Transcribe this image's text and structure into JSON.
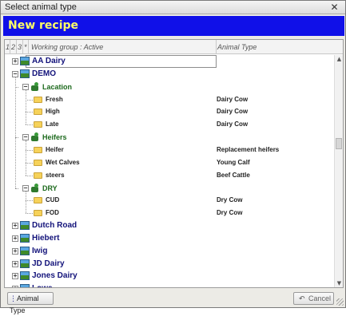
{
  "window": {
    "title": "Select animal type",
    "close_glyph": "✕"
  },
  "banner": {
    "title": "New recipe"
  },
  "grid": {
    "header": {
      "col1": "1",
      "col2": "2",
      "col3": "3",
      "col4": "*",
      "working_group": "Working group : Active",
      "animal_type": "Animal Type"
    }
  },
  "tree": [
    {
      "kind": "top",
      "label": "AA Dairy",
      "expander": "+",
      "selected": true
    },
    {
      "kind": "top",
      "label": "DEMO",
      "expander": "−"
    },
    {
      "kind": "group",
      "label": "Lacation",
      "expander": "−"
    },
    {
      "kind": "leaf",
      "label": "Fresh",
      "animal_type": "Dairy Cow"
    },
    {
      "kind": "leaf",
      "label": "High",
      "animal_type": "Dairy Cow"
    },
    {
      "kind": "leaf",
      "label": "Late",
      "animal_type": "Dairy Cow"
    },
    {
      "kind": "group",
      "label": "Heifers",
      "expander": "−"
    },
    {
      "kind": "leaf",
      "label": "Heifer",
      "animal_type": "Replacement heifers"
    },
    {
      "kind": "leaf",
      "label": "Wet Calves",
      "animal_type": "Young Calf"
    },
    {
      "kind": "leaf",
      "label": "steers",
      "animal_type": "Beef Cattle"
    },
    {
      "kind": "group",
      "label": "DRY",
      "expander": "−"
    },
    {
      "kind": "leaf",
      "label": "CUD",
      "animal_type": "Dry Cow"
    },
    {
      "kind": "leaf",
      "label": "FOD",
      "animal_type": "Dry Cow"
    },
    {
      "kind": "top",
      "label": "Dutch Road",
      "expander": "+"
    },
    {
      "kind": "top",
      "label": "Hiebert",
      "expander": "+"
    },
    {
      "kind": "top",
      "label": "Iwig",
      "expander": "+"
    },
    {
      "kind": "top",
      "label": "JD Dairy",
      "expander": "+"
    },
    {
      "kind": "top",
      "label": "Jones Dairy",
      "expander": "+"
    },
    {
      "kind": "top",
      "label": "Lowe",
      "expander": "+"
    }
  ],
  "icons": {
    "farm": "farm-icon",
    "group": "group-icon",
    "folder": "folder-icon"
  },
  "buttons": {
    "animal_type": "Animal Type",
    "cancel": "Cancel"
  },
  "colors": {
    "banner_bg": "#1010e8",
    "banner_text": "#ffff66",
    "top_level_text": "#12127a",
    "group_text": "#1d6a1d"
  }
}
